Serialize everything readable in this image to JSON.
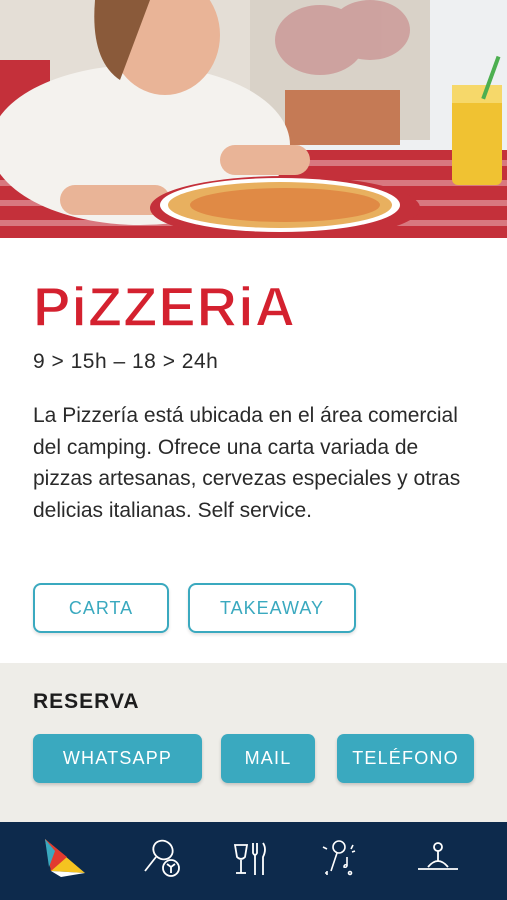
{
  "hero": {
    "image": "girl-eating-pizza-photo"
  },
  "title": "PiZZERiA",
  "hours": "9 > 15h – 18 > 24h",
  "description": "La Pizzería está ubicada en el área comercial del camping. Ofrece una carta variada de pizzas artesanas, cervezas especiales y otras delicias italianas. Self service.",
  "buttons": {
    "carta": "CARTA",
    "takeaway": "TAKEAWAY"
  },
  "reserva": {
    "title": "RESERVA",
    "whatsapp": "WHATSAPP",
    "mail": "MAIL",
    "telefono": "TELÉFONO"
  },
  "tabbar": {
    "items": [
      {
        "icon": "sail-logo-icon"
      },
      {
        "icon": "sports-icon"
      },
      {
        "icon": "restaurant-icon"
      },
      {
        "icon": "entertainment-icon"
      },
      {
        "icon": "relax-icon"
      }
    ]
  },
  "colors": {
    "accent": "#3aa9bf",
    "title_red": "#d4212f",
    "tabbar": "#0d2a4c",
    "reserva_bg": "#eeede8"
  }
}
